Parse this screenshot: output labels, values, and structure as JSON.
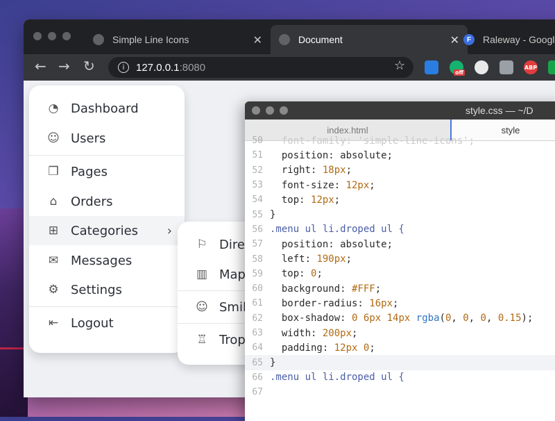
{
  "browser": {
    "tabs": [
      {
        "title": "Simple Line Icons",
        "close": "✕",
        "favicon": "globe-icon"
      },
      {
        "title": "Document",
        "close": "✕",
        "favicon": "globe-icon"
      },
      {
        "title": "Raleway - Googl",
        "favicon_letter": "F"
      }
    ],
    "url_host": "127.0.0.1",
    "url_port": ":8080",
    "extensions": [
      {
        "name": "screenshot-ext",
        "color": "#2a7de1",
        "label": ""
      },
      {
        "name": "grammarly-ext",
        "color": "#15b36e",
        "label": "off"
      },
      {
        "name": "block-ext",
        "color": "#e0e0e0",
        "label": ""
      },
      {
        "name": "camera-ext",
        "color": "#9aa0a6",
        "label": ""
      },
      {
        "name": "adblock-ext",
        "color": "#e23d3d",
        "label": "ABP"
      },
      {
        "name": "shield-ext",
        "color": "#17a34a",
        "label": ""
      }
    ]
  },
  "menu": {
    "items": [
      {
        "label": "Dashboard",
        "icon": "speedometer-icon"
      },
      {
        "label": "Users",
        "icon": "people-icon"
      },
      {
        "label": "Pages",
        "icon": "docs-icon"
      },
      {
        "label": "Orders",
        "icon": "handbag-icon"
      },
      {
        "label": "Categories",
        "icon": "organization-icon"
      },
      {
        "label": "Messages",
        "icon": "envelope-icon"
      },
      {
        "label": "Settings",
        "icon": "settings-icon"
      },
      {
        "label": "Logout",
        "icon": "logout-icon"
      }
    ],
    "submenu": [
      {
        "label": "Direc",
        "icon": "directions-icon"
      },
      {
        "label": "Map",
        "icon": "map-icon"
      },
      {
        "label": "Smile",
        "icon": "emotsmile-icon"
      },
      {
        "label": "Troph",
        "icon": "trophy-icon"
      }
    ]
  },
  "editor": {
    "window_title": "style.css — ~/D",
    "tabs": [
      "index.html",
      "style"
    ],
    "lines": [
      {
        "n": "50",
        "text": "  font-family: 'simple-line-icons';"
      },
      {
        "n": "51",
        "text": "  position: absolute;"
      },
      {
        "n": "52",
        "text": "  right: 18px;"
      },
      {
        "n": "53",
        "text": "  font-size: 12px;"
      },
      {
        "n": "54",
        "text": "  top: 12px;"
      },
      {
        "n": "55",
        "text": "}"
      },
      {
        "n": "56",
        "text": ".menu ul li.droped ul {"
      },
      {
        "n": "57",
        "text": "  position: absolute;"
      },
      {
        "n": "58",
        "text": "  left: 190px;"
      },
      {
        "n": "59",
        "text": "  top: 0;"
      },
      {
        "n": "60",
        "text": "  background: #FFF;"
      },
      {
        "n": "61",
        "text": "  border-radius: 16px;"
      },
      {
        "n": "62",
        "text": "  box-shadow: 0 6px 14px rgba(0, 0, 0, 0.15);"
      },
      {
        "n": "63",
        "text": "  width: 200px;"
      },
      {
        "n": "64",
        "text": "  padding: 12px 0;"
      },
      {
        "n": "65",
        "text": "}"
      },
      {
        "n": "66",
        "text": ".menu ul li.droped ul {"
      },
      {
        "n": "67",
        "text": ""
      }
    ]
  },
  "colors": {
    "accent": "#4a78d8",
    "number": "#b06a12"
  }
}
